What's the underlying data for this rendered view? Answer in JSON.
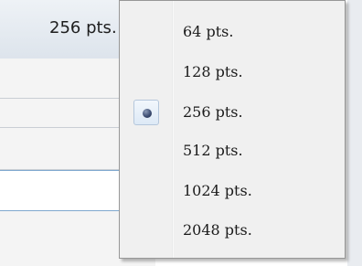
{
  "selector": {
    "current_value": "256 pts."
  },
  "menu": {
    "items": [
      {
        "label": "64 pts.",
        "selected": false
      },
      {
        "label": "128 pts.",
        "selected": false
      },
      {
        "label": "256 pts.",
        "selected": true
      },
      {
        "label": "512 pts.",
        "selected": false
      },
      {
        "label": "1024 pts.",
        "selected": false
      },
      {
        "label": "2048 pts.",
        "selected": false
      }
    ]
  },
  "colors": {
    "menu_background": "#f0f0f0",
    "menu_border": "#979797",
    "selected_box_border": "#b5c7dc",
    "radio_dot": "#3f4f74"
  }
}
